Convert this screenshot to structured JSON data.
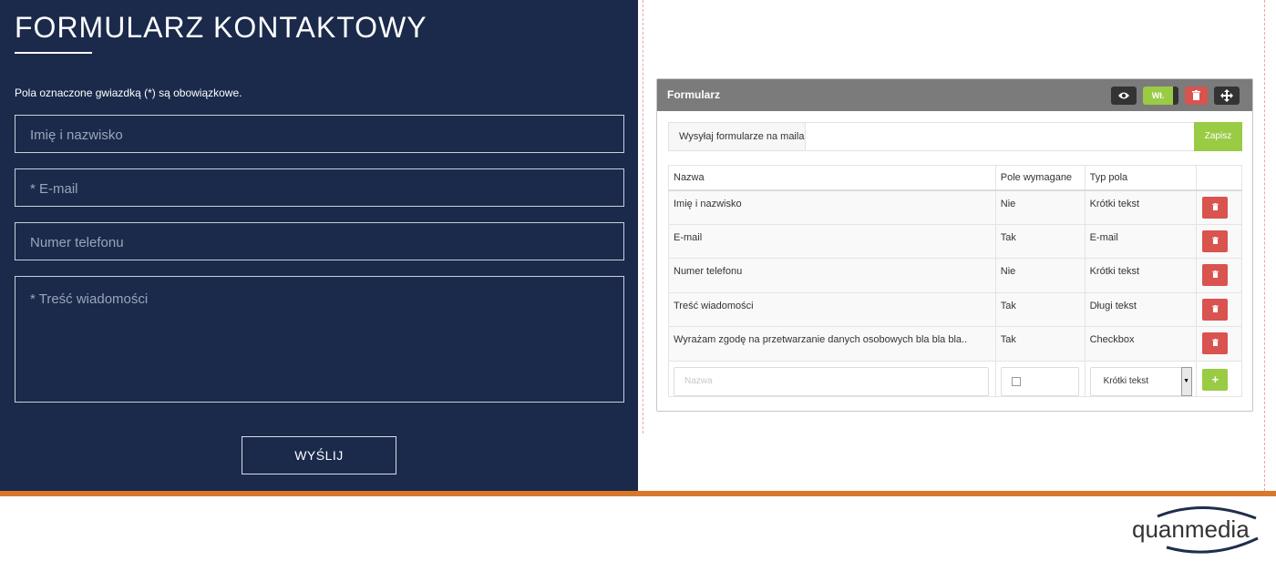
{
  "form": {
    "title": "FORMULARZ KONTAKTOWY",
    "required_note": "Pola oznaczone gwiazdką (*) są obowiązkowe.",
    "fields": [
      {
        "placeholder": "Imię i nazwisko"
      },
      {
        "placeholder": "* E-mail"
      },
      {
        "placeholder": "Numer telefonu"
      },
      {
        "placeholder": "* Treść wiadomości"
      }
    ],
    "submit_label": "WYŚLIJ"
  },
  "panel": {
    "title": "Formularz",
    "toggle_label": "Wł.",
    "mail_label": "Wysyłaj formularze na maila",
    "mail_value": "",
    "save_label": "Zapisz",
    "columns": [
      "Nazwa",
      "Pole wymagane",
      "Typ pola"
    ],
    "rows": [
      {
        "name": "Imię i nazwisko",
        "required": "Nie",
        "type": "Krótki tekst"
      },
      {
        "name": "E-mail",
        "required": "Tak",
        "type": "E-mail"
      },
      {
        "name": "Numer telefonu",
        "required": "Nie",
        "type": "Krótki tekst"
      },
      {
        "name": "Treść wiadomości",
        "required": "Tak",
        "type": "Długi tekst"
      },
      {
        "name": "Wyrażam zgodę na przetwarzanie danych osobowych bla bla bla..",
        "required": "Tak",
        "type": "Checkbox"
      }
    ],
    "new_row": {
      "name_placeholder": "Nazwa",
      "type_selected": "Krótki tekst"
    }
  },
  "logo_text": "quanmedia",
  "colors": {
    "panel_bg": "#1b2a4b",
    "accent_green": "#9acb45",
    "danger_red": "#d9534f",
    "orange_bar": "#d9782c",
    "panel_header": "#7b7b7b"
  },
  "icons": [
    "eye-icon",
    "trash-icon",
    "move-icon",
    "plus-icon",
    "chevron-down-icon"
  ]
}
